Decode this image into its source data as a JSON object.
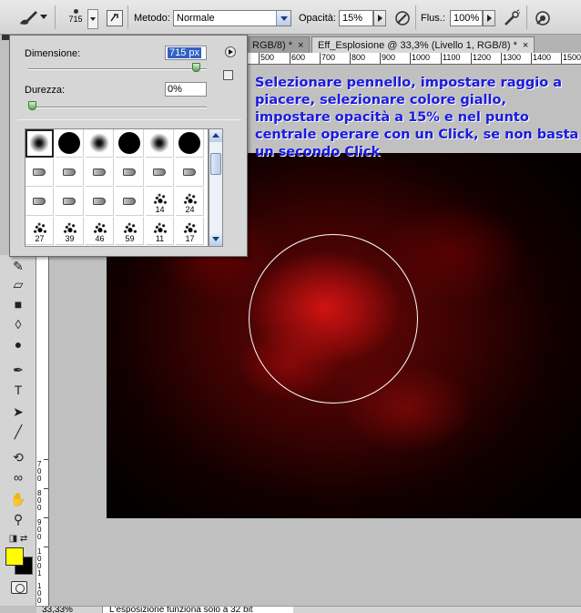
{
  "options_bar": {
    "brush_size_preview": "715",
    "mode_label": "Metodo:",
    "mode_value": "Normale",
    "opacity_label": "Opacità:",
    "opacity_value": "15%",
    "flow_label": "Flus.:",
    "flow_value": "100%"
  },
  "document_tabs": [
    {
      "label": "RGB/8) *",
      "active": false
    },
    {
      "label": "Eff_Esplosione @ 33,3% (Livello 1, RGB/8) *",
      "active": true
    }
  ],
  "ruler": {
    "labels": [
      "500",
      "600",
      "700",
      "800",
      "900",
      "1000",
      "1100",
      "1200",
      "1300",
      "1400",
      "1500"
    ]
  },
  "vertical_ruler_digits": [
    "7",
    "0",
    "0",
    "8",
    "0",
    "0",
    "9",
    "0",
    "0",
    "1",
    "0",
    "0",
    "1",
    "1",
    "0",
    "0"
  ],
  "brush_picker": {
    "size_label": "Dimensione:",
    "size_value": "715 px",
    "hardness_label": "Durezza:",
    "hardness_value": "0%",
    "size_fraction": 0.96,
    "hardness_fraction": 0.0,
    "presets": [
      {
        "kind": "soft",
        "num": ""
      },
      {
        "kind": "hard",
        "num": ""
      },
      {
        "kind": "soft",
        "num": ""
      },
      {
        "kind": "hard",
        "num": ""
      },
      {
        "kind": "soft",
        "num": ""
      },
      {
        "kind": "hard",
        "num": ""
      },
      {
        "kind": "tip",
        "num": ""
      },
      {
        "kind": "tip",
        "num": ""
      },
      {
        "kind": "tip",
        "num": ""
      },
      {
        "kind": "tip",
        "num": ""
      },
      {
        "kind": "tip",
        "num": ""
      },
      {
        "kind": "tip",
        "num": ""
      },
      {
        "kind": "tip",
        "num": ""
      },
      {
        "kind": "tip",
        "num": ""
      },
      {
        "kind": "tip",
        "num": ""
      },
      {
        "kind": "tip",
        "num": ""
      },
      {
        "kind": "scatter",
        "num": "14"
      },
      {
        "kind": "scatter",
        "num": "24"
      },
      {
        "kind": "scatter",
        "num": "27"
      },
      {
        "kind": "scatter",
        "num": "39"
      },
      {
        "kind": "scatter",
        "num": "46"
      },
      {
        "kind": "scatter",
        "num": "59"
      },
      {
        "kind": "scatter",
        "num": "11"
      },
      {
        "kind": "scatter",
        "num": "17"
      }
    ]
  },
  "instruction_text": "Selezionare pennello, impostare raggio a piacere, selezionare colore giallo, impostare opacità a 15% e nel punto centrale operare con un Click, se non basta un secondo Click",
  "colors": {
    "foreground": "#ffff00",
    "background": "#000000",
    "instruction": "#1a1adf"
  },
  "status_bar": {
    "zoom": "33,33%",
    "message": "L'esposizione funziona solo a 32 bit"
  }
}
